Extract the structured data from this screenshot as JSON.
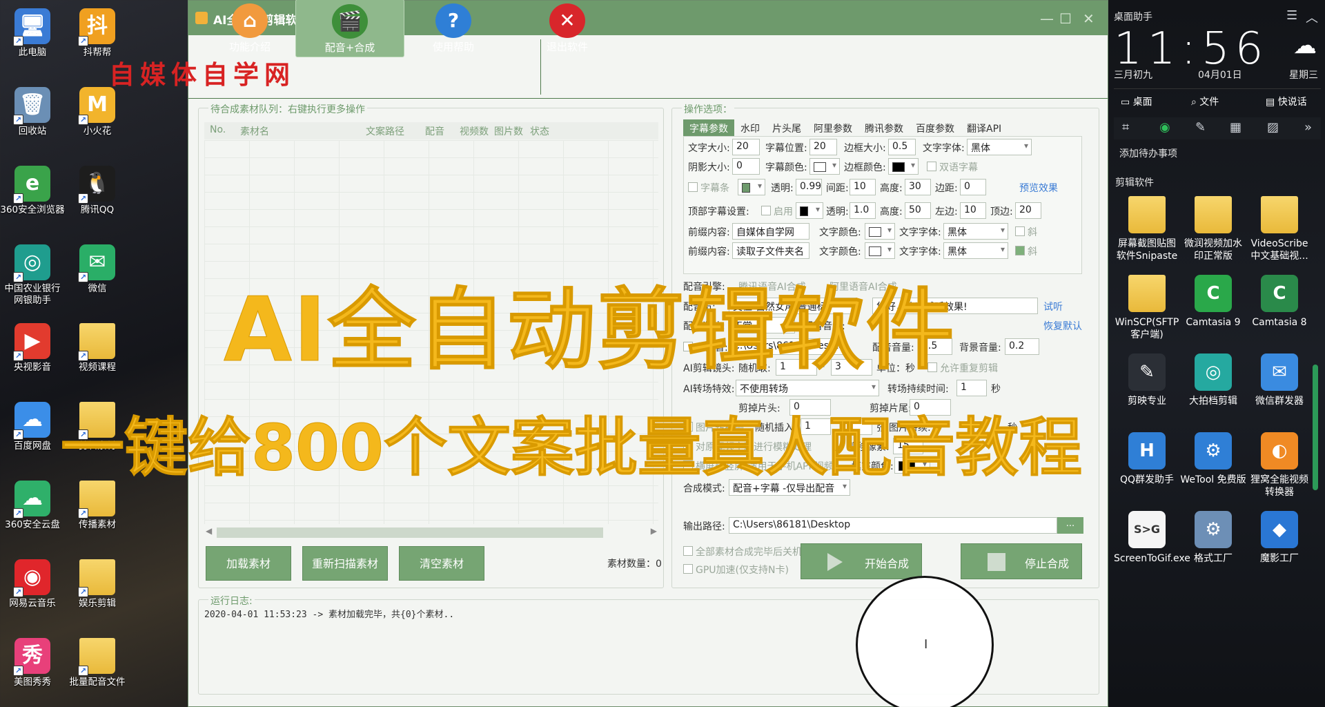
{
  "watermark": "自媒体自学网",
  "desktop": {
    "icons": [
      {
        "label": "此电脑",
        "name": "this-pc-icon",
        "glyph": "🖥",
        "color": "#3a7bd5"
      },
      {
        "label": "回收站",
        "name": "recycle-bin-icon",
        "glyph": "🗑",
        "color": "#6b8fb5"
      },
      {
        "label": "360安全浏览器",
        "name": "browser-360-icon",
        "glyph": "e",
        "color": "#3aa34a"
      },
      {
        "label": "中国农业银行网银助手",
        "name": "abc-bank-icon",
        "glyph": "◎",
        "color": "#1f9d8e"
      },
      {
        "label": "央视影音",
        "name": "cctv-player-icon",
        "glyph": "▶",
        "color": "#e23b2e"
      },
      {
        "label": "百度网盘",
        "name": "baidu-netdisk-icon",
        "glyph": "☁",
        "color": "#3b8ee8"
      },
      {
        "label": "360安全云盘",
        "name": "cloud-360-icon",
        "glyph": "☁",
        "color": "#2fb06a"
      },
      {
        "label": "网易云音乐",
        "name": "netease-music-icon",
        "glyph": "◉",
        "color": "#e0262b"
      },
      {
        "label": "美图秀秀",
        "name": "meitu-icon",
        "glyph": "秀",
        "color": "#e8407a"
      },
      {
        "label": "抖帮帮",
        "name": "doubangbang-icon",
        "glyph": "抖",
        "color": "#f0a020"
      },
      {
        "label": "小火花",
        "name": "spark-icon",
        "glyph": "M",
        "color": "#f2b42c"
      },
      {
        "label": "腾讯QQ",
        "name": "qq-icon",
        "glyph": "🐧",
        "color": "#1d1d1d"
      },
      {
        "label": "微信",
        "name": "wechat-icon",
        "glyph": "✉",
        "color": "#2aae67"
      },
      {
        "label": "视频课程",
        "name": "folder-video-course-icon",
        "glyph": "",
        "color": "#e9b93a"
      },
      {
        "label": "剪辑素材",
        "name": "folder-edit-material-icon",
        "glyph": "",
        "color": "#e9b93a"
      },
      {
        "label": "传播素材",
        "name": "folder-share-material-icon",
        "glyph": "",
        "color": "#e9b93a"
      },
      {
        "label": "娱乐剪辑",
        "name": "folder-fun-edit-icon",
        "glyph": "",
        "color": "#e9b93a"
      },
      {
        "label": "批量配音文件",
        "name": "folder-batch-dub-icon",
        "glyph": "",
        "color": "#e9b93a"
      }
    ]
  },
  "window": {
    "title": "AI全自动剪辑软件V5.3",
    "min": "—",
    "max": "☐",
    "close": "✕",
    "toolbar": [
      {
        "label": "功能介绍",
        "name": "tool-intro",
        "glyph": "⌂",
        "color": "#f19a3e"
      },
      {
        "label": "配音+合成",
        "name": "tool-dub-compose",
        "glyph": "🎬",
        "color": "#3e8f3a"
      },
      {
        "label": "使用帮助",
        "name": "tool-help",
        "glyph": "?",
        "color": "#2f7fd6"
      },
      {
        "label": "退出软件",
        "name": "tool-exit",
        "glyph": "✕",
        "color": "#d8262b"
      }
    ]
  },
  "queue": {
    "title": "待合成素材队列：右键执行更多操作",
    "columns": [
      "No.",
      "素材名",
      "文案路径",
      "配音",
      "视频数",
      "图片数",
      "状态"
    ],
    "buttons": [
      "加载素材",
      "重新扫描素材",
      "清空素材"
    ],
    "count_label": "素材数量：0"
  },
  "options": {
    "title": "操作选项：",
    "tabs": [
      "字幕参数",
      "水印",
      "片头尾",
      "阿里参数",
      "腾讯参数",
      "百度参数",
      "翻译API"
    ],
    "r1": {
      "font_size_lbl": "文字大小:",
      "font_size": "20",
      "pos_lbl": "字幕位置:",
      "pos": "20",
      "border_lbl": "边框大小:",
      "border": "0.5",
      "font_lbl": "文字字体:",
      "font": "黑体"
    },
    "r2": {
      "shadow_lbl": "阴影大小:",
      "shadow": "0",
      "color_lbl": "字幕颜色:",
      "bcolor_lbl": "边框颜色:",
      "bilingual": "双语字幕"
    },
    "r3": {
      "bar": "字幕条",
      "alpha_lbl": "透明:",
      "alpha": "0.99",
      "gap_lbl": "间距:",
      "gap": "10",
      "height_lbl": "高度:",
      "height": "30",
      "margin_lbl": "边距:",
      "margin": "0",
      "preview": "预览效果"
    },
    "r4": {
      "top_lbl": "顶部字幕设置:",
      "enable": "启用",
      "alpha_lbl": "透明:",
      "alpha": "1.0",
      "height_lbl": "高度:",
      "height": "50",
      "left_lbl": "左边:",
      "left": "10",
      "top2_lbl": "顶边:",
      "top2": "20"
    },
    "r5": {
      "prefix_lbl": "前缀内容:",
      "prefix": "自媒体自学网",
      "tcolor_lbl": "文字颜色:",
      "tfont_lbl": "文字字体:",
      "tfont": "黑体",
      "italic": "斜"
    },
    "r6": {
      "prefix_lbl": "前缀内容:",
      "prefix": "读取子文件夹名",
      "tcolor_lbl": "文字颜色:",
      "tfont_lbl": "文字字体:",
      "tfont": "黑体",
      "italic": "斜"
    },
    "engine_lbl": "配音引擎:",
    "engine_a": "腾讯语音AI合成",
    "engine_b": "阿里语音AI合成",
    "voice_lbl": "配音员:",
    "voice": "艾佳-自然女声 普通标",
    "sample": "您好，欢迎试听效果!",
    "listen": "试听",
    "speed_lbl": "配音语速:",
    "speed": "正常",
    "vol_lbl": "配音音量:",
    "reset": "恢复默认",
    "bgm_lbl": "背景音:",
    "bgm_path": "C:\\Users\\86181\\Desktop",
    "bgm_vol_lbl": "配音音量:",
    "bgm_vol": "1.5",
    "bg_vol_lbl": "背景音量:",
    "bg_vol": "0.2",
    "clip_lbl": "AI剪辑镜头:",
    "random_lbl": "随机取:",
    "rand_a": "1",
    "dash": "-",
    "rand_b": "3",
    "unit": "单位：秒",
    "allow_repeat": "允许重复剪辑",
    "trans_lbl": "AI转场特效:",
    "trans": "不使用转场",
    "trans_dur_lbl": "转场持续时间:",
    "trans_dur": "1",
    "sec": "秒",
    "head_lbl": "剪掉片头:",
    "head": "0",
    "tail_lbl": "剪掉片尾:",
    "tail": "0",
    "img_conv": "图片转视频",
    "img_ins": "随机插入",
    "img_a": "1",
    "img_b": "3",
    "img_unit": "张",
    "img_dur_lbl": "图片持续:",
    "img_sec": "秒",
    "blur": "对原视频字幕进行模糊处理",
    "offset_lbl": "偏移像素:",
    "offset": "15",
    "portrait": "横屏转竖屏(适用于手机APP视频)",
    "fill_lbl": "填充颜色:",
    "mode_lbl": "合成模式:",
    "mode": "配音+字幕 -仅导出配音",
    "out_lbl": "输出路径:",
    "out_path": "C:\\Users\\86181\\Desktop",
    "browse": "...",
    "shutdown": "全部素材合成完毕后关机",
    "gpu": "GPU加速(仅支持N卡)",
    "start": "开始合成",
    "stop": "停止合成"
  },
  "log": {
    "title": "运行日志:",
    "line": "2020-04-01 11:53:23 -> 素材加载完毕，共{0}个素材.."
  },
  "overlay": {
    "title": "AI全自动剪辑软件",
    "subtitle": "一键给800个文案批量真人配音教程"
  },
  "right": {
    "header": "桌面助手",
    "clock": "11:56",
    "lunar": "三月初九",
    "date": "04月01日",
    "weekday": "星期三",
    "quick": [
      "桌面",
      "文件",
      "快说话"
    ],
    "todo": "添加待办事项",
    "section": "剪辑软件",
    "apps": [
      {
        "label": "屏幕截图贴图软件Snipaste",
        "name": "snipaste-icon",
        "glyph": "",
        "color": "#e9b93a"
      },
      {
        "label": "微润视频加水印正常版",
        "name": "watermark-tool-icon",
        "glyph": "",
        "color": "#e9b93a"
      },
      {
        "label": "VideoScribe中文基础视...",
        "name": "videoscribe-icon",
        "glyph": "",
        "color": "#e9b93a"
      },
      {
        "label": "WinSCP(SFTP客户端)",
        "name": "winscp-icon",
        "glyph": "",
        "color": "#e9b93a"
      },
      {
        "label": "Camtasia 9",
        "name": "camtasia9-icon",
        "glyph": "C",
        "color": "#2aa84a"
      },
      {
        "label": "Camtasia 8",
        "name": "camtasia8-icon",
        "glyph": "C",
        "color": "#2a8a4a"
      },
      {
        "label": "剪映专业",
        "name": "jianying-icon",
        "glyph": "✎",
        "color": "#2b2f36"
      },
      {
        "label": "大拍档剪辑",
        "name": "dapaidang-icon",
        "glyph": "◎",
        "color": "#25a9a0"
      },
      {
        "label": "微信群发器",
        "name": "wechat-sender-icon",
        "glyph": "✉",
        "color": "#3a8be0"
      },
      {
        "label": "QQ群发助手",
        "name": "qq-sender-icon",
        "glyph": "H",
        "color": "#2f7fd6"
      },
      {
        "label": "WeTool 免费版",
        "name": "wetool-icon",
        "glyph": "⚙",
        "color": "#2f7fd6"
      },
      {
        "label": "狸窝全能视频转换器",
        "name": "liwo-converter-icon",
        "glyph": "◐",
        "color": "#f08a24"
      },
      {
        "label": "ScreenToGif.exe",
        "name": "screentogif-icon",
        "glyph": "S>G",
        "color": "#f5f5f5"
      },
      {
        "label": "格式工厂",
        "name": "format-factory-icon",
        "glyph": "⚙",
        "color": "#6d8fb6"
      },
      {
        "label": "魔影工厂",
        "name": "moying-icon",
        "glyph": "◆",
        "color": "#2a77d4"
      }
    ]
  }
}
